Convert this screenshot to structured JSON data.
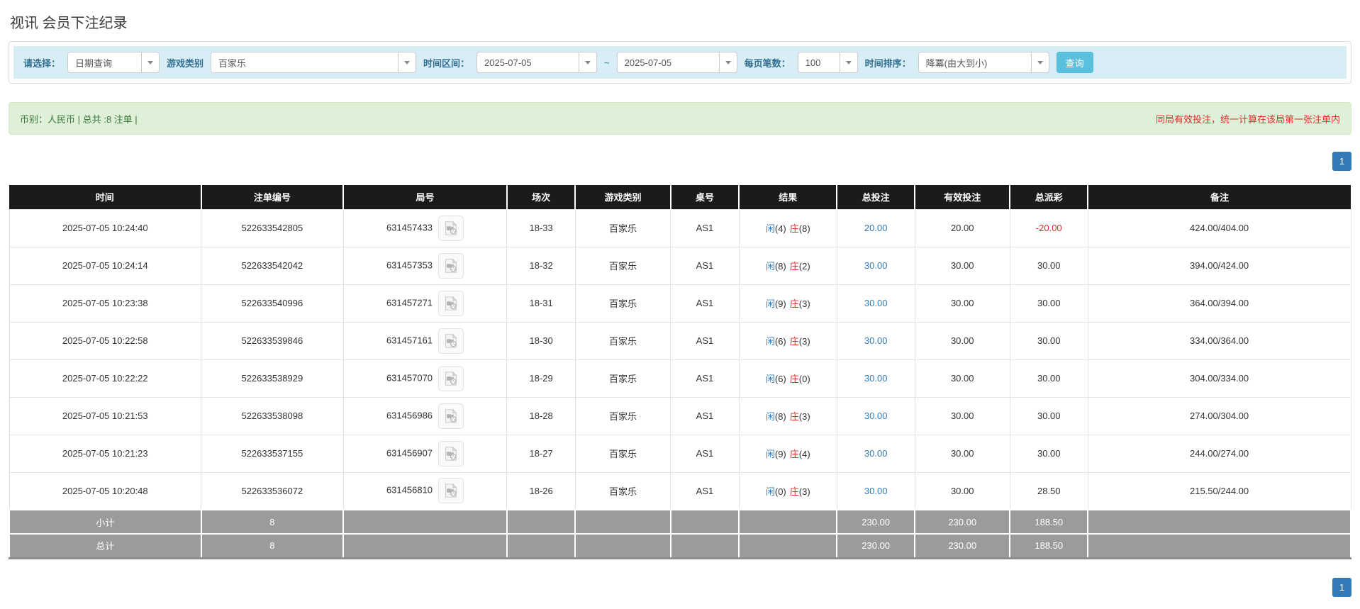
{
  "page_title": "视讯 会员下注纪录",
  "colors": {
    "accent_blue": "#337ab7",
    "filter_bar_bg": "#d9edf7",
    "filter_label_blue": "#31708f",
    "success_bar_bg": "#dff0d8",
    "success_text": "#3c763d",
    "danger_red": "#e02b2b",
    "table_header_bg": "#1b1b1b",
    "summary_row_bg": "#9b9b9b",
    "search_button_bg": "#5bc0de"
  },
  "filters": {
    "query_type_label": "请选择：",
    "query_type_value": "日期查询",
    "game_type_label": "游戏类别",
    "game_type_value": "百家乐",
    "date_range_label": "时间区间：",
    "date_from": "2025-07-05",
    "tilde": "~",
    "date_to": "2025-07-05",
    "per_page_label": "每页笔数：",
    "per_page_value": "100",
    "sort_label": "时间排序：",
    "sort_value": "降冪(由大到小)",
    "search_button_label": "查询"
  },
  "summary_bar": {
    "left_text": "币别：人民币 | 总共 :8 注单 |",
    "right_text": "同局有效投注，统一计算在该局第一张注单内"
  },
  "pagination": {
    "page": "1"
  },
  "table": {
    "headers": [
      "时间",
      "注单编号",
      "局号",
      "场次",
      "游戏类别",
      "桌号",
      "结果",
      "总投注",
      "有效投注",
      "总派彩",
      "备注"
    ],
    "rows": [
      {
        "time": "2025-07-05 10:24:40",
        "bet_id": "522633542805",
        "round_id": "631457433",
        "session": "18-33",
        "game_type": "百家乐",
        "table_no": "AS1",
        "result_p_label": "闲",
        "result_p_num": "(4)",
        "result_b_label": "庄",
        "result_b_num": "(8)",
        "total_bet": "20.00",
        "valid_bet": "20.00",
        "total_payout": "-20.00",
        "remark": "424.00/404.00"
      },
      {
        "time": "2025-07-05 10:24:14",
        "bet_id": "522633542042",
        "round_id": "631457353",
        "session": "18-32",
        "game_type": "百家乐",
        "table_no": "AS1",
        "result_p_label": "闲",
        "result_p_num": "(8)",
        "result_b_label": "庄",
        "result_b_num": "(2)",
        "total_bet": "30.00",
        "valid_bet": "30.00",
        "total_payout": "30.00",
        "remark": "394.00/424.00"
      },
      {
        "time": "2025-07-05 10:23:38",
        "bet_id": "522633540996",
        "round_id": "631457271",
        "session": "18-31",
        "game_type": "百家乐",
        "table_no": "AS1",
        "result_p_label": "闲",
        "result_p_num": "(9)",
        "result_b_label": "庄",
        "result_b_num": "(3)",
        "total_bet": "30.00",
        "valid_bet": "30.00",
        "total_payout": "30.00",
        "remark": "364.00/394.00"
      },
      {
        "time": "2025-07-05 10:22:58",
        "bet_id": "522633539846",
        "round_id": "631457161",
        "session": "18-30",
        "game_type": "百家乐",
        "table_no": "AS1",
        "result_p_label": "闲",
        "result_p_num": "(6)",
        "result_b_label": "庄",
        "result_b_num": "(3)",
        "total_bet": "30.00",
        "valid_bet": "30.00",
        "total_payout": "30.00",
        "remark": "334.00/364.00"
      },
      {
        "time": "2025-07-05 10:22:22",
        "bet_id": "522633538929",
        "round_id": "631457070",
        "session": "18-29",
        "game_type": "百家乐",
        "table_no": "AS1",
        "result_p_label": "闲",
        "result_p_num": "(6)",
        "result_b_label": "庄",
        "result_b_num": "(0)",
        "total_bet": "30.00",
        "valid_bet": "30.00",
        "total_payout": "30.00",
        "remark": "304.00/334.00"
      },
      {
        "time": "2025-07-05 10:21:53",
        "bet_id": "522633538098",
        "round_id": "631456986",
        "session": "18-28",
        "game_type": "百家乐",
        "table_no": "AS1",
        "result_p_label": "闲",
        "result_p_num": "(8)",
        "result_b_label": "庄",
        "result_b_num": "(3)",
        "total_bet": "30.00",
        "valid_bet": "30.00",
        "total_payout": "30.00",
        "remark": "274.00/304.00"
      },
      {
        "time": "2025-07-05 10:21:23",
        "bet_id": "522633537155",
        "round_id": "631456907",
        "session": "18-27",
        "game_type": "百家乐",
        "table_no": "AS1",
        "result_p_label": "闲",
        "result_p_num": "(9)",
        "result_b_label": "庄",
        "result_b_num": "(4)",
        "total_bet": "30.00",
        "valid_bet": "30.00",
        "total_payout": "30.00",
        "remark": "244.00/274.00"
      },
      {
        "time": "2025-07-05 10:20:48",
        "bet_id": "522633536072",
        "round_id": "631456810",
        "session": "18-26",
        "game_type": "百家乐",
        "table_no": "AS1",
        "result_p_label": "闲",
        "result_p_num": "(0)",
        "result_b_label": "庄",
        "result_b_num": "(3)",
        "total_bet": "30.00",
        "valid_bet": "30.00",
        "total_payout": "28.50",
        "remark": "215.50/244.00"
      }
    ],
    "subtotal": {
      "label": "小计",
      "count": "8",
      "total_bet": "230.00",
      "valid_bet": "230.00",
      "total_payout": "188.50"
    },
    "total": {
      "label": "总计",
      "count": "8",
      "total_bet": "230.00",
      "valid_bet": "230.00",
      "total_payout": "188.50"
    }
  }
}
